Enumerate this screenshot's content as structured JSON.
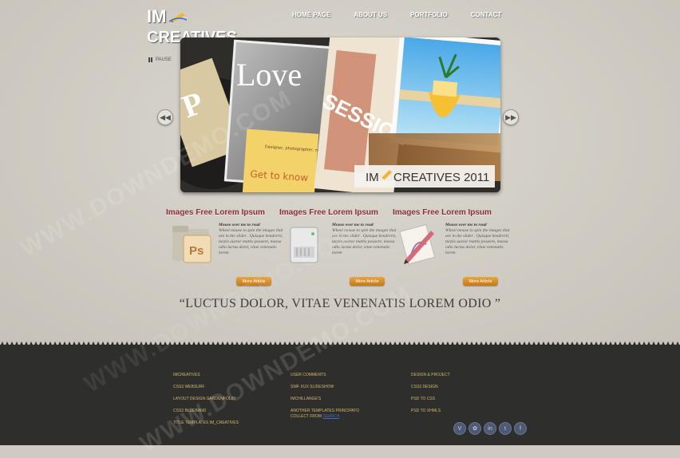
{
  "logo": {
    "line1": "IM",
    "line2": "CREATIVES"
  },
  "nav": {
    "items": [
      "HOME PAGE",
      "ABOUT US",
      "PORTFOLIO",
      "CONTACT"
    ]
  },
  "slider": {
    "pause_label": "PAUSE",
    "photo_text_love": "Love",
    "photo_text_session": "SESSION",
    "note_text": "Designer, photographer, maker of beautiful websites and so more",
    "note_cta": "Get to know",
    "caption_brand": "IM",
    "caption_rest": "CREATIVES 2011"
  },
  "columns": [
    {
      "title": "Images Free Lorem Ipsum",
      "icon": "photoshop-folder-icon",
      "lead": "Mouse over me to read",
      "body": "Wheel mouse to spin the images that are in the slider . Quisque hendrerit, turpis auctor mattis posuere, massa odio luctus dolor, vitae venenatis lorem",
      "button": "More Article"
    },
    {
      "title": "Images Free Lorem Ipsum",
      "icon": "server-icon",
      "lead": "Mouse over me to read",
      "body": "Wheel mouse to spin the images that are in the slider . Quisque hendrerit, turpis auctor mattis posuere, massa odio luctus dolor, vitae venenatis lorem",
      "button": "More Article"
    },
    {
      "title": "Images Free Lorem Ipsum",
      "icon": "pencil-drawing-icon",
      "lead": "Mouse over me to read",
      "body": "Wheel mouse to spin the images that are in the slider . Quisque hendrerit, turpis auctor mattis posuere, massa odio luctus dolor, vitae venenatis lorem",
      "button": "More Article"
    }
  ],
  "quote": "“LUCTUS DOLOR, VITAE VENENATIS LOREM ODIO ”",
  "footer": {
    "col1": [
      "IMCREATIVES",
      "CSS3 WEBSURF",
      "LAYOUT DESIGN GARDENFOLIO",
      "CSS3 BLUEBAND",
      "TITLE TEMPLATES IM_CREATIVES"
    ],
    "col2": [
      "USER COMMENTS",
      "SWF XUX SLIDESHOW",
      "IMCHILLANGE'S",
      "ANOTHER TEMPLATES PRINCIPATO",
      "COLLECT FROM"
    ],
    "col2_link": "SEARCH",
    "col3": [
      "DESIGN & PROJECT",
      "CSS3 DESIGN",
      "PSD TO CSS",
      "PSD TO XHMLS"
    ],
    "social": [
      "vimeo-icon",
      "flickr-icon",
      "linkedin-icon",
      "twitter-icon",
      "facebook-icon"
    ],
    "social_glyphs": [
      "V",
      "✿",
      "in",
      "t",
      "f"
    ]
  },
  "watermark": "WWW.DOWNDEMO.COM",
  "colors": {
    "accent": "#8a2f3a",
    "button": "#d98f2a",
    "footer_bg": "#2e2e2d",
    "footer_text": "#d3b86a",
    "page_bg": "#cfcbc2"
  }
}
